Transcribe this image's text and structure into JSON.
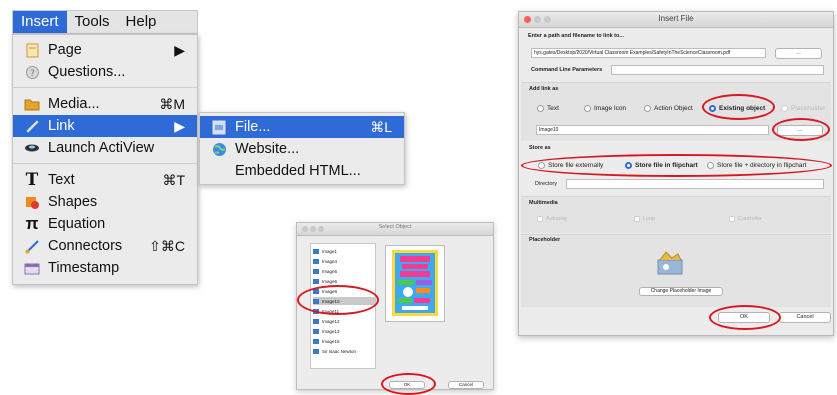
{
  "menubar": {
    "items": [
      {
        "label": "Insert",
        "active": true
      },
      {
        "label": "Tools"
      },
      {
        "label": "Help"
      }
    ]
  },
  "insert_menu": {
    "page": {
      "label": "Page",
      "icon": "page-icon"
    },
    "questions": {
      "label": "Questions...",
      "icon": "questions-icon"
    },
    "media": {
      "label": "Media...",
      "icon": "media-folder-icon",
      "shortcut": "⌘M"
    },
    "link": {
      "label": "Link",
      "icon": "link-icon"
    },
    "launch": {
      "label": "Launch ActiView",
      "icon": "actiview-icon"
    },
    "text": {
      "label": "Text",
      "icon": "text-icon",
      "shortcut": "⌘T"
    },
    "shapes": {
      "label": "Shapes",
      "icon": "shapes-icon"
    },
    "equation": {
      "label": "Equation",
      "icon": "pi-icon"
    },
    "connectors": {
      "label": "Connectors",
      "icon": "connector-icon",
      "shortcut": "⇧⌘C"
    },
    "timestamp": {
      "label": "Timestamp",
      "icon": "calendar-icon"
    }
  },
  "link_submenu": {
    "file": {
      "label": "File...",
      "icon": "file-icon",
      "shortcut": "⌘L"
    },
    "website": {
      "label": "Website...",
      "icon": "globe-icon"
    },
    "embedded": {
      "label": "Embedded HTML..."
    }
  },
  "insert_file": {
    "title": "Insert File",
    "path_label": "Enter a path and filename to link to...",
    "path_value": "hys.gates/Desktop/2020/Virtual Classroom Examples/SafetyInTheScienceClassroom.pdf",
    "browse_label": "...",
    "cmd_label": "Command Line Parameters",
    "cmd_value": "",
    "add_link_label": "Add link as",
    "link_options": [
      "Text",
      "Image Icon",
      "Action Object",
      "Existing object",
      "Placeholder"
    ],
    "object_value": "Image10",
    "object_browse_label": "...",
    "store_label": "Store as",
    "store_options": [
      "Store file externally",
      "Store file in flipchart",
      "Store file + directory in flipchart"
    ],
    "directory_label": "Directory",
    "multimedia_label": "Multimedia",
    "multimedia_options": [
      "Autoplay",
      "Loop",
      "Controller"
    ],
    "placeholder_label": "Placeholder",
    "change_placeholder_label": "Change Placeholder Image",
    "ok_label": "OK",
    "cancel_label": "Cancel"
  },
  "select_object": {
    "title": "Select Object",
    "items": [
      "Image1",
      "Image4",
      "Image5",
      "Image6",
      "Image8",
      "Image10",
      "Image11",
      "Image12",
      "Image13",
      "Image15",
      "Sir Isaac Newton"
    ],
    "selected": "Image10",
    "ok_label": "OK",
    "cancel_label": "Cancel"
  },
  "annotation_color": "#d8181f",
  "accent_color": "#2f6bd6"
}
